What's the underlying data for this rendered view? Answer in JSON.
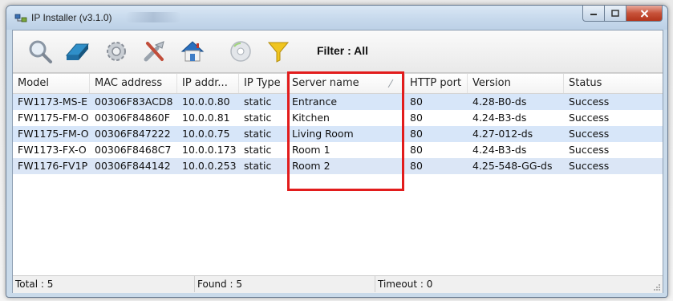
{
  "window": {
    "title": "IP Installer (v3.1.0)"
  },
  "toolbar": {
    "buttons": [
      {
        "name": "search-button",
        "icon": "magnifier-icon"
      },
      {
        "name": "erase-button",
        "icon": "eraser-icon"
      },
      {
        "name": "settings-button",
        "icon": "gear-icon"
      },
      {
        "name": "tools-button",
        "icon": "tools-icon"
      },
      {
        "name": "home-button",
        "icon": "house-icon"
      },
      {
        "name": "disc-button",
        "icon": "disc-icon"
      },
      {
        "name": "filter-button",
        "icon": "funnel-icon"
      }
    ],
    "filter_label": "Filter :  All"
  },
  "table": {
    "columns": [
      "Model",
      "MAC address",
      "IP addr...",
      "IP Type",
      "Server name",
      "HTTP port",
      "Version",
      "Status"
    ],
    "rows": [
      [
        "FW1173-MS-E",
        "00306F83ACD8",
        "10.0.0.80",
        "static",
        "Entrance",
        "80",
        "4.28-B0-ds",
        "Success"
      ],
      [
        "FW1175-FM-O",
        "00306F84860F",
        "10.0.0.81",
        "static",
        "Kitchen",
        "80",
        "4.24-B3-ds",
        "Success"
      ],
      [
        "FW1175-FM-O",
        "00306F847222",
        "10.0.0.75",
        "static",
        "Living Room",
        "80",
        "4.27-012-ds",
        "Success"
      ],
      [
        "FW1173-FX-O",
        "00306F8468C7",
        "10.0.0.173",
        "static",
        "Room 1",
        "80",
        "4.24-B3-ds",
        "Success"
      ],
      [
        "FW1176-FV1P",
        "00306F844142",
        "10.0.0.253",
        "static",
        "Room 2",
        "80",
        "4.25-548-GG-ds",
        "Success"
      ]
    ]
  },
  "status": {
    "total": "Total : 5",
    "found": "Found : 5",
    "timeout": "Timeout : 0"
  },
  "colors": {
    "selection": "#d7e6f9",
    "highlight_box": "#e21c1c",
    "close_button": "#c75239"
  }
}
